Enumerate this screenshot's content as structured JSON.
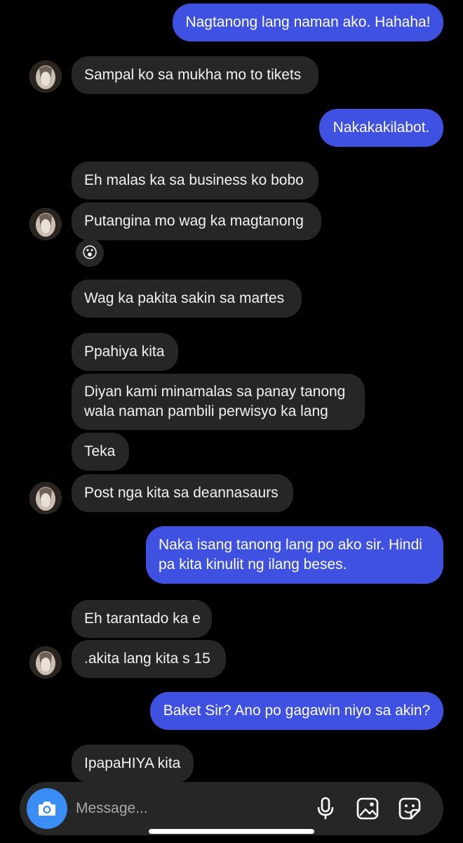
{
  "thread": {
    "messages": [
      {
        "sender": "me",
        "text": "Nagtanong lang naman ako. Hahaha!"
      },
      {
        "sender": "them",
        "text": "Sampal ko sa mukha mo to tikets"
      },
      {
        "sender": "me",
        "text": "Nakakakilabot."
      },
      {
        "sender": "them",
        "text": "Eh malas ka sa business ko bobo"
      },
      {
        "sender": "them",
        "text": "Putangina mo wag ka magtanong"
      },
      {
        "sender": "them",
        "reaction": "😮"
      },
      {
        "sender": "them",
        "text": "Wag ka pakita sakin sa martes"
      },
      {
        "sender": "them",
        "text": "Ppahiya kita"
      },
      {
        "sender": "them",
        "lines": [
          "Diyan kami minamalas sa panay tanong",
          "wala naman pambili perwisyo ka lang"
        ]
      },
      {
        "sender": "them",
        "text": "Teka"
      },
      {
        "sender": "them",
        "text": "Post nga kita sa deannasaurs"
      },
      {
        "sender": "me",
        "lines": [
          "Naka isang tanong lang po ako sir. Hindi",
          "pa kita kinulit ng ilang beses."
        ]
      },
      {
        "sender": "them",
        "text": "Eh tarantado ka e"
      },
      {
        "sender": "them",
        "text": ".akita lang kita s 15"
      },
      {
        "sender": "me",
        "text": "Baket Sir? Ano po gagawin niyo sa akin?"
      },
      {
        "sender": "them",
        "text": "IpapaHIYA kita"
      }
    ]
  },
  "composer": {
    "placeholder": "Message...",
    "icons": [
      "camera-icon",
      "microphone-icon",
      "gallery-icon",
      "sticker-icon"
    ]
  },
  "colors": {
    "background": "#000000",
    "incoming_bubble": "#262626",
    "outgoing_bubble": "#3f51e0",
    "camera_button": "#3a8df5"
  }
}
